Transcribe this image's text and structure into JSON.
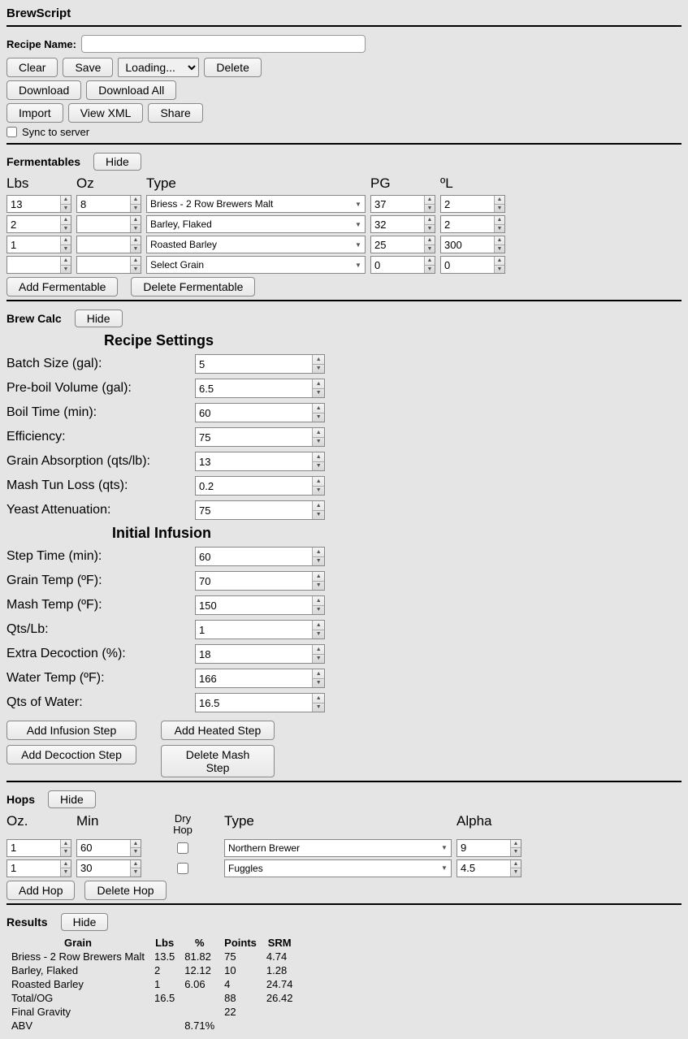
{
  "app": {
    "title": "BrewScript"
  },
  "recipe": {
    "name_label": "Recipe Name:",
    "name_value": ""
  },
  "toolbar": {
    "clear": "Clear",
    "save": "Save",
    "loading": "Loading...",
    "delete": "Delete",
    "download": "Download",
    "download_all": "Download All",
    "import": "Import",
    "view_xml": "View XML",
    "share": "Share",
    "sync": "Sync to server"
  },
  "sections": {
    "fermentables": "Fermentables",
    "brewcalc": "Brew Calc",
    "hops": "Hops",
    "results": "Results",
    "hide": "Hide"
  },
  "ferm": {
    "headers": {
      "lbs": "Lbs",
      "oz": "Oz",
      "type": "Type",
      "pg": "PG",
      "l": "ºL"
    },
    "rows": [
      {
        "lbs": "13",
        "oz": "8",
        "type": "Briess - 2 Row Brewers Malt",
        "pg": "37",
        "l": "2"
      },
      {
        "lbs": "2",
        "oz": "",
        "type": "Barley, Flaked",
        "pg": "32",
        "l": "2"
      },
      {
        "lbs": "1",
        "oz": "",
        "type": "Roasted Barley",
        "pg": "25",
        "l": "300"
      },
      {
        "lbs": "",
        "oz": "",
        "type": "Select Grain",
        "pg": "0",
        "l": "0"
      }
    ],
    "add": "Add Fermentable",
    "del": "Delete Fermentable"
  },
  "calc": {
    "recipe_title": "Recipe Settings",
    "infusion_title": "Initial Infusion",
    "fields": {
      "batch": {
        "label": "Batch Size (gal):",
        "val": "5"
      },
      "preboil": {
        "label": "Pre-boil Volume (gal):",
        "val": "6.5"
      },
      "boil": {
        "label": "Boil Time (min):",
        "val": "60"
      },
      "eff": {
        "label": "Efficiency:",
        "val": "75"
      },
      "absorb": {
        "label": "Grain Absorption (qts/lb):",
        "val": "13"
      },
      "tunloss": {
        "label": "Mash Tun Loss (qts):",
        "val": "0.2"
      },
      "atten": {
        "label": "Yeast Attenuation:",
        "val": "75"
      },
      "steptime": {
        "label": "Step Time (min):",
        "val": "60"
      },
      "graintemp": {
        "label": "Grain Temp (ºF):",
        "val": "70"
      },
      "mashtemp": {
        "label": "Mash Temp (ºF):",
        "val": "150"
      },
      "qtslb": {
        "label": "Qts/Lb:",
        "val": "1"
      },
      "decoc": {
        "label": "Extra Decoction (%):",
        "val": "18"
      },
      "watertemp": {
        "label": "Water Temp (ºF):",
        "val": "166"
      },
      "qtswater": {
        "label": "Qts of Water:",
        "val": "16.5"
      }
    },
    "btn_add_inf": "Add Infusion Step",
    "btn_add_heat": "Add Heated Step",
    "btn_add_dec": "Add Decoction Step",
    "btn_del_mash": "Delete Mash Step"
  },
  "hops": {
    "headers": {
      "oz": "Oz.",
      "min": "Min",
      "dry": "Dry\nHop",
      "type": "Type",
      "alpha": "Alpha"
    },
    "rows": [
      {
        "oz": "1",
        "min": "60",
        "dry": false,
        "type": "Northern Brewer",
        "alpha": "9"
      },
      {
        "oz": "1",
        "min": "30",
        "dry": false,
        "type": "Fuggles",
        "alpha": "4.5"
      }
    ],
    "add": "Add Hop",
    "del": "Delete Hop"
  },
  "results": {
    "headers": {
      "grain": "Grain",
      "lbs": "Lbs",
      "pct": "%",
      "pts": "Points",
      "srm": "SRM"
    },
    "rows": [
      {
        "grain": "Briess - 2 Row Brewers Malt",
        "lbs": "13.5",
        "pct": "81.82",
        "pts": "75",
        "srm": "4.74"
      },
      {
        "grain": "Barley, Flaked",
        "lbs": "2",
        "pct": "12.12",
        "pts": "10",
        "srm": "1.28"
      },
      {
        "grain": "Roasted Barley",
        "lbs": "1",
        "pct": "6.06",
        "pts": "4",
        "srm": "24.74"
      },
      {
        "grain": "Total/OG",
        "lbs": "16.5",
        "pct": "",
        "pts": "88",
        "srm": "26.42"
      },
      {
        "grain": "Final Gravity",
        "lbs": "",
        "pct": "",
        "pts": "22",
        "srm": ""
      },
      {
        "grain": "ABV",
        "lbs": "",
        "pct": "8.71%",
        "pts": "",
        "srm": ""
      }
    ]
  }
}
